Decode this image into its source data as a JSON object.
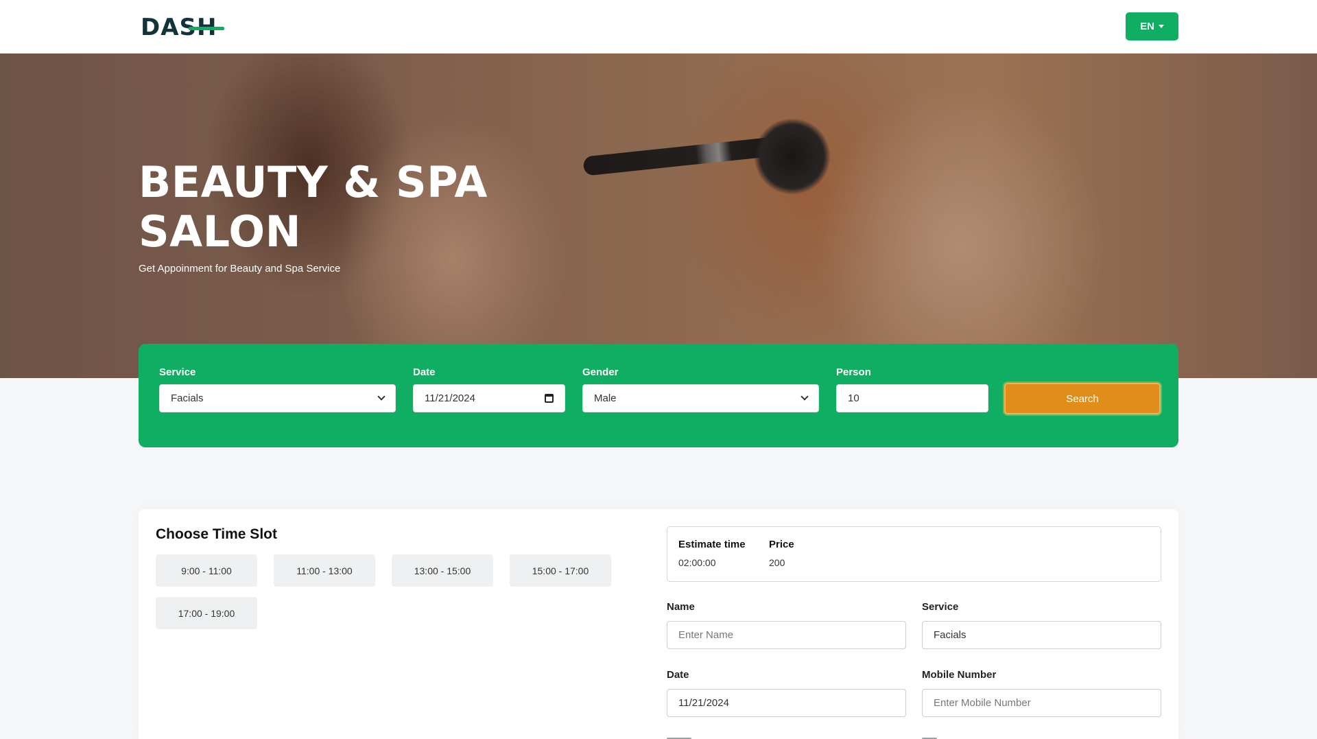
{
  "header": {
    "logo_text": "DASH",
    "language_label": "EN"
  },
  "hero": {
    "title_line1": "BEAUTY & SPA",
    "title_line2": "SALON",
    "subtitle": "Get Appoinment for Beauty and Spa Service"
  },
  "search": {
    "service_label": "Service",
    "service_value": "Facials",
    "date_label": "Date",
    "date_value": "11/21/2024",
    "gender_label": "Gender",
    "gender_value": "Male",
    "person_label": "Person",
    "person_value": "10",
    "search_label": "Search"
  },
  "slots": {
    "title": "Choose Time Slot",
    "items": [
      "9:00 - 11:00",
      "11:00 - 13:00",
      "13:00 - 15:00",
      "15:00 - 17:00",
      "17:00 - 19:00"
    ]
  },
  "estimate": {
    "time_label": "Estimate time",
    "time_value": "02:00:00",
    "price_label": "Price",
    "price_value": "200"
  },
  "form": {
    "name_label": "Name",
    "name_placeholder": "Enter Name",
    "service_label": "Service",
    "service_value": "Facials",
    "date_label": "Date",
    "date_value": "11/21/2024",
    "mobile_label": "Mobile Number",
    "mobile_placeholder": "Enter Mobile Number"
  },
  "colors": {
    "brand_green": "#0fae62",
    "search_orange": "#e08d19",
    "logo_dark": "#14323a"
  }
}
